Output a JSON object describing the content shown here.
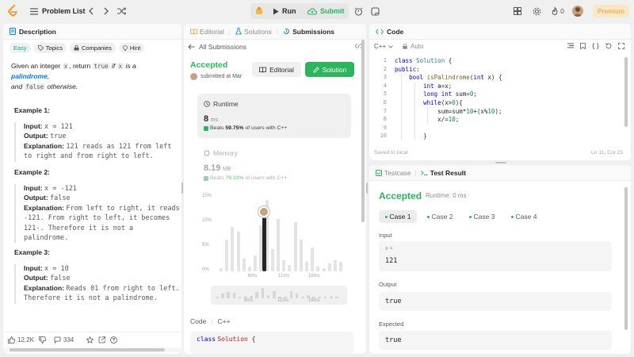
{
  "topbar": {
    "problem_list": "Problem List",
    "run": "Run",
    "submit": "Submit",
    "notif_count": "0",
    "premium": "Premium"
  },
  "left": {
    "tab_description": "Description",
    "tags": {
      "difficulty": "Easy",
      "topics": "Topics",
      "companies": "Companies",
      "hint": "Hint"
    },
    "statement": {
      "p1": "Given an integer ",
      "x": "x",
      "p2": ", return ",
      "true": "true",
      "p3": " if ",
      "x2": "x",
      "p4": " is a ",
      "palindrome": "palindrome",
      "p5": ",",
      "p6": "and ",
      "false": "false",
      "p7": " otherwise."
    },
    "examples": [
      {
        "title": "Example 1:",
        "input": "x = 121",
        "output": "true",
        "explanation": "121 reads as 121 from left to right and from right to left."
      },
      {
        "title": "Example 2:",
        "input": "x = -121",
        "output": "false",
        "explanation": "From left to right, it reads -121. From right to left, it becomes 121-. Therefore it is not a palindrome."
      },
      {
        "title": "Example 3:",
        "input": "x = 10",
        "output": "false",
        "explanation": "Reads 01 from right to left. Therefore it is not a palindrome."
      }
    ],
    "labels": {
      "input": "Input:",
      "output": "Output:",
      "explanation": "Explanation:"
    },
    "footer": {
      "likes": "12.2K",
      "comments": "334"
    }
  },
  "middle": {
    "tabs": {
      "editorial": "Editorial",
      "solutions": "Solutions",
      "submissions": "Submissions"
    },
    "back": "All Submissions",
    "status": "Accepted",
    "submitted": "submitted at Mar",
    "btn_editorial": "Editorial",
    "btn_solution": "Solution",
    "runtime": {
      "label": "Runtime",
      "value": "8",
      "unit": "ms",
      "beats_pre": "Beats ",
      "beats_pct": "59.75%",
      "beats_post": " of users with C++"
    },
    "memory": {
      "label": "Memory",
      "value": "8.19",
      "unit": "MB",
      "beats_pre": "Beats ",
      "beats_pct": "79.33%",
      "beats_post": " of users with C++"
    },
    "chart": {
      "yticks": [
        "15%",
        "10%",
        "5%",
        "0%"
      ],
      "xticks": [
        "6ms",
        "11ms",
        "16ms"
      ],
      "minimap_xticks": [
        "6ms",
        "11ms",
        "16ms"
      ]
    },
    "code_section": {
      "label": "Code",
      "lang": "C++",
      "first_line_kw": "class",
      "first_line_cls": "Solution",
      "first_line_rest": " {"
    }
  },
  "code_panel": {
    "title": "Code",
    "lang": "C++",
    "auto": "Auto",
    "lines": [
      "class Solution {",
      "public:",
      "    bool isPalindrome(int x) {",
      "        int a=x;",
      "        long int sum=0;",
      "        while(x>0){",
      "            sum=sum*10+(x%10);",
      "            x/=10;",
      "",
      "        }"
    ],
    "line_numbers": [
      "1",
      "2",
      "3",
      "4",
      "5",
      "6",
      "7",
      "8",
      "9",
      "10"
    ],
    "saved": "Saved to local",
    "cursor": "Ln 11, Col 23"
  },
  "result_panel": {
    "tab_testcase": "Testcase",
    "tab_result": "Test Result",
    "status": "Accepted",
    "runtime": "Runtime: 0 ms",
    "cases": [
      "Case 1",
      "Case 2",
      "Case 3",
      "Case 4"
    ],
    "input_label": "Input",
    "var": "x =",
    "input_value": "121",
    "output_label": "Output",
    "output_value": "true",
    "expected_label": "Expected",
    "expected_value": "true"
  },
  "colors": {
    "accent_green": "#2db55d",
    "link_blue": "#007aff",
    "premium": "#e6a23c"
  }
}
